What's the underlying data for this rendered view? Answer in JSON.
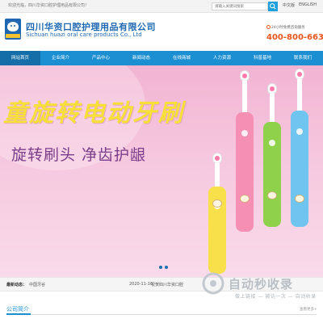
{
  "topbar": {
    "welcome": "欢迎光临，四川华资口腔护理用品有限公司！",
    "search_placeholder": "请输入关键词搜索",
    "lang_cn": "中文版",
    "lang_en": "ENGLISH"
  },
  "header": {
    "company_cn": "四川华资口腔护理用品有限公司",
    "company_en": "Sichuan huazi oral care products Co., Ltd",
    "hotline_label": "24小时免费咨询服务",
    "hotline_number": "400-800-6632"
  },
  "nav": {
    "items": [
      "网站首页",
      "企业简介",
      "产品中心",
      "新闻动态",
      "在线商城",
      "人力资源",
      "科普基地",
      "联系我们"
    ]
  },
  "banner": {
    "headline": "童旋转电动牙刷",
    "subline": "旋转刷头  净齿护龈"
  },
  "news": {
    "label": "最新动态：",
    "tag": "中国牙谷",
    "date": "2020-11-16",
    "title": "祝贺四川华资口腔"
  },
  "watermark": {
    "text": "自动秒收录",
    "sub": "做上链接 — 被访一次 — 自动收录"
  },
  "section": {
    "title": "公司简介",
    "more": "查看更多+"
  },
  "colors": {
    "brand_blue": "#1b8fd2",
    "hotline_orange": "#e8541e",
    "headline_yellow": "#f7df3a"
  }
}
